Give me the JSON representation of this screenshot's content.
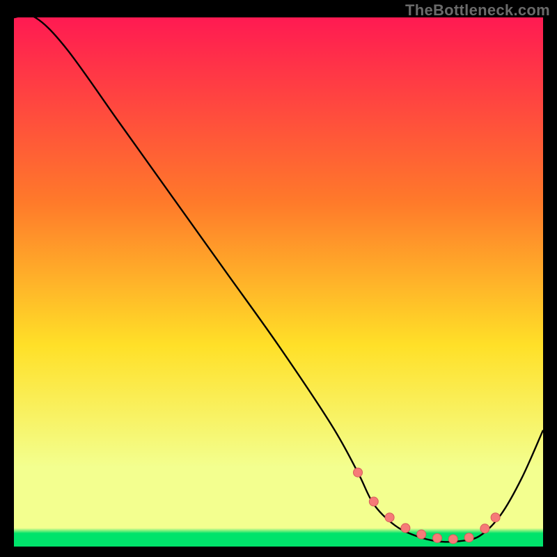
{
  "watermark": "TheBottleneck.com",
  "colors": {
    "bg": "#000000",
    "grad_top": "#ff1a52",
    "grad_mid1": "#ff7a2a",
    "grad_mid2": "#ffe028",
    "grad_low": "#f3ff8f",
    "grad_bottom": "#00e36b",
    "curve": "#000000",
    "dot_fill": "#f67a78",
    "dot_stroke": "#d65c5a"
  },
  "chart_data": {
    "type": "line",
    "title": "",
    "xlabel": "",
    "ylabel": "",
    "xlim": [
      0,
      100
    ],
    "ylim": [
      0,
      100
    ],
    "series": [
      {
        "name": "bottleneck-curve",
        "x": [
          0,
          4,
          10,
          20,
          30,
          40,
          50,
          60,
          65,
          68,
          72,
          76,
          80,
          84,
          88,
          92,
          96,
          100
        ],
        "values": [
          100,
          100,
          94,
          80,
          66,
          52,
          38,
          23,
          14,
          8,
          4,
          2,
          1,
          1,
          2,
          6,
          13,
          22
        ]
      }
    ],
    "markers": {
      "name": "highlight-dots",
      "x": [
        65,
        68,
        71,
        74,
        77,
        80,
        83,
        86,
        89,
        91
      ],
      "values": [
        14,
        8.5,
        5.5,
        3.5,
        2.3,
        1.6,
        1.4,
        1.7,
        3.4,
        5.5
      ]
    }
  }
}
